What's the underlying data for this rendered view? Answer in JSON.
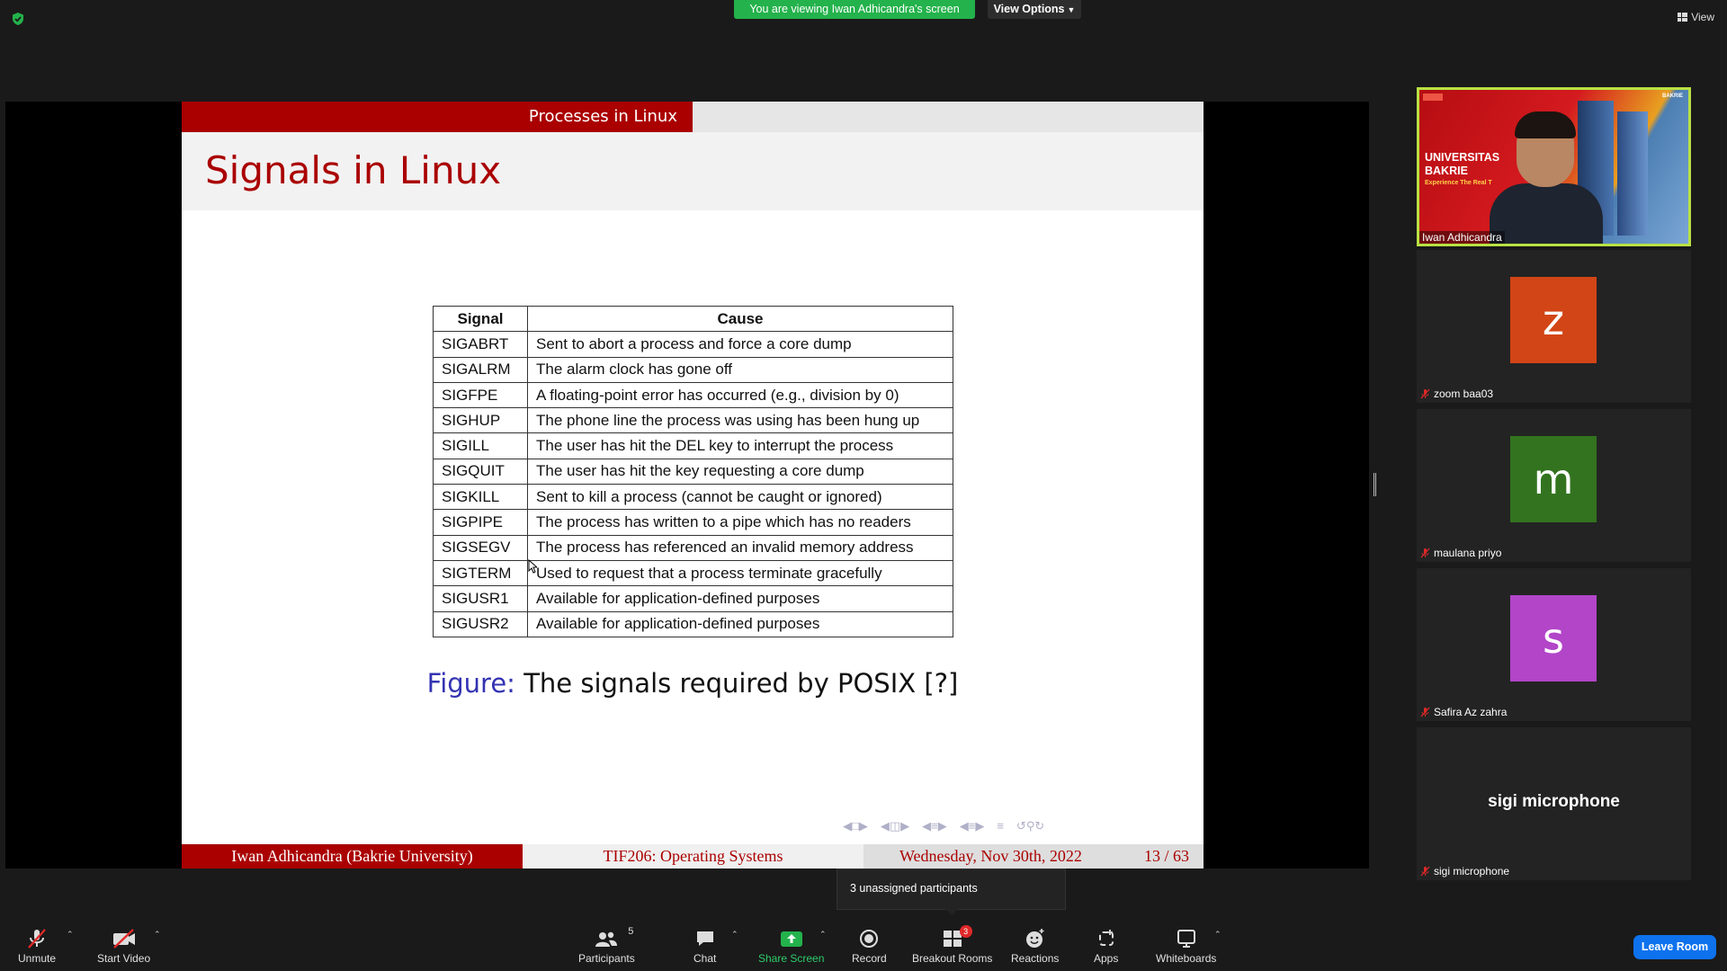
{
  "top": {
    "viewing_banner": "You are viewing Iwan Adhicandra's screen",
    "view_options": "View Options",
    "view_label": "View"
  },
  "slide": {
    "section": "Processes in Linux",
    "title": "Signals in Linux",
    "table": {
      "headers": [
        "Signal",
        "Cause"
      ],
      "rows": [
        [
          "SIGABRT",
          "Sent to abort a process and force a core dump"
        ],
        [
          "SIGALRM",
          "The alarm clock has gone off"
        ],
        [
          "SIGFPE",
          "A floating-point error has occurred (e.g., division by 0)"
        ],
        [
          "SIGHUP",
          "The phone line the process was using has been hung up"
        ],
        [
          "SIGILL",
          "The user has hit the DEL key to interrupt the process"
        ],
        [
          "SIGQUIT",
          "The user has hit the key requesting a core dump"
        ],
        [
          "SIGKILL",
          "Sent to kill a process (cannot be caught or ignored)"
        ],
        [
          "SIGPIPE",
          "The process has written to a pipe which has no readers"
        ],
        [
          "SIGSEGV",
          "The process has referenced an invalid memory address"
        ],
        [
          "SIGTERM",
          "Used to request that a process terminate gracefully"
        ],
        [
          "SIGUSR1",
          "Available for application-defined purposes"
        ],
        [
          "SIGUSR2",
          "Available for application-defined purposes"
        ]
      ]
    },
    "caption_label": "Figure:",
    "caption_text": "The signals required by POSIX [?]",
    "footer": {
      "author": "Iwan Adhicandra  (Bakrie University)",
      "course": "TIF206: Operating Systems",
      "date": "Wednesday, Nov 30th, 2022",
      "page": "13 / 63"
    }
  },
  "participants": {
    "video": {
      "name": "Iwan Adhicandra",
      "banner_line1": "UNIVERSITAS",
      "banner_line2": "BAKRIE",
      "banner_sub": "Experience The Real T",
      "logo_right": "BAKRIE"
    },
    "tiles": [
      {
        "initial": "z",
        "name": "zoom baa03",
        "color": "#d24516"
      },
      {
        "initial": "m",
        "name": "maulana priyo",
        "color": "#33731f"
      },
      {
        "initial": "s",
        "name": "Safira Az zahra",
        "color": "#b245c8"
      }
    ],
    "text_tile": {
      "big": "sigi microphone",
      "name": "sigi microphone"
    }
  },
  "tooltip": "3 unassigned participants",
  "toolbar": {
    "unmute": "Unmute",
    "start_video": "Start Video",
    "participants": "Participants",
    "participants_count": "5",
    "chat": "Chat",
    "share_screen": "Share Screen",
    "record": "Record",
    "breakout_rooms": "Breakout Rooms",
    "breakout_badge": "3",
    "reactions": "Reactions",
    "apps": "Apps",
    "whiteboards": "Whiteboards",
    "leave": "Leave Room"
  },
  "colors": {
    "accent_green": "#23b24b",
    "slide_red": "#aa0000",
    "leave_blue": "#0e72ed",
    "active_speaker": "#b9e143"
  }
}
